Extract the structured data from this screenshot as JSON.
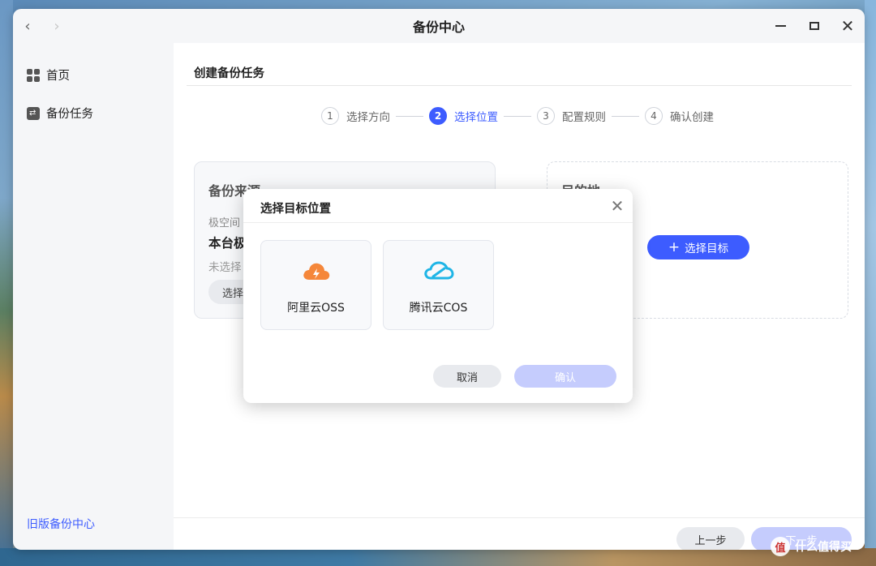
{
  "window": {
    "title": "备份中心",
    "back_icon": "‹",
    "forward_icon": "›",
    "close_icon": "✕"
  },
  "sidebar": {
    "items": [
      {
        "label": "首页",
        "icon": "grid-icon"
      },
      {
        "label": "备份任务",
        "icon": "backup-icon"
      }
    ],
    "old_version_link": "旧版备份中心"
  },
  "main": {
    "title": "创建备份任务",
    "steps": [
      {
        "num": "1",
        "label": "选择方向",
        "active": false
      },
      {
        "num": "2",
        "label": "选择位置",
        "active": true
      },
      {
        "num": "3",
        "label": "配置规则",
        "active": false
      },
      {
        "num": "4",
        "label": "确认创建",
        "active": false
      }
    ],
    "source": {
      "title": "备份来源",
      "label": "极空间",
      "device": "本台极",
      "hint": "未选择",
      "button": "选择"
    },
    "destination": {
      "title": "目的地",
      "button_plus": "+",
      "button": "选择目标"
    },
    "footer": {
      "prev": "上一步",
      "next": "下一步"
    }
  },
  "dialog": {
    "title": "选择目标位置",
    "close_icon": "✕",
    "options": [
      {
        "label": "阿里云OSS",
        "icon": "aliyun-cloud-icon",
        "color": "#f5873a"
      },
      {
        "label": "腾讯云COS",
        "icon": "tencent-cloud-icon",
        "color": "#1fb5e6"
      }
    ],
    "cancel": "取消",
    "confirm": "确认"
  },
  "watermark": {
    "badge": "值",
    "text": "什么值得买"
  },
  "colors": {
    "accent": "#3d5cff",
    "accent_disabled": "#c5ccfd"
  }
}
